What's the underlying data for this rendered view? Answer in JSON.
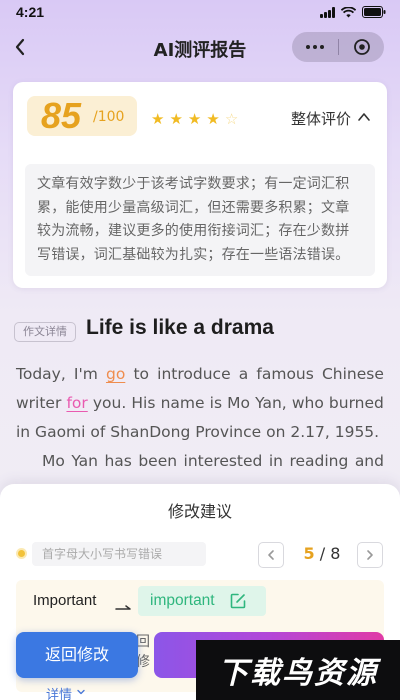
{
  "status_bar": {
    "time": "4:21"
  },
  "nav": {
    "title": "AI测评报告"
  },
  "score_card": {
    "score": "85",
    "total": "/100",
    "rating_stars": 4.5,
    "rating_max": 5,
    "overall_label": "整体评价",
    "evaluation_lines": [
      "文章有效字数少于该考试字数要求；有一定词汇积",
      "累，能使用少量高级词汇，但还需要多积累；文章",
      "较为流畅，建议更多的使用衔接词汇；存在少数拼",
      "写错误，词汇基础较为扎实；存在一些语法错误。"
    ]
  },
  "essay": {
    "tag": "作文详情",
    "title": "Life is like a drama",
    "line1": {
      "a": "Today,",
      "b": "I'm",
      "err": "go",
      "c": "to",
      "d": "introduce",
      "e": "a",
      "f": "famous",
      "g": "Chinese"
    },
    "line2": {
      "a": "writer",
      "err": "for",
      "b": "you.",
      "c": "His",
      "d": "name",
      "e": "is",
      "f": "Mo",
      "g": "Yan,",
      "h": "who",
      "i": "burned"
    },
    "line3": "in Gaomi of ShanDong Province on 2.17, 1955.",
    "line4": {
      "a": "Mo",
      "b": "Yan",
      "c": "has",
      "d": "been",
      "e": "interested",
      "f": "in",
      "g": "reading",
      "h": "and"
    }
  },
  "sheet": {
    "title": "修改建议",
    "tip": "首字母大小写书写错误",
    "pager_current": "5",
    "pager_sep": " / 8",
    "original_word": "Important",
    "suggested_word": "important",
    "hidden_note": "回\n修",
    "details_label": "详情"
  },
  "actions": {
    "revise_label": "返回修改"
  },
  "watermark": "下载鸟资源",
  "colors": {
    "accent_orange": "#e6a21f",
    "error_orange": "#ef8d4e",
    "error_pink": "#e95ab0",
    "success_green": "#2fb67e",
    "primary_blue": "#3b78e2"
  }
}
